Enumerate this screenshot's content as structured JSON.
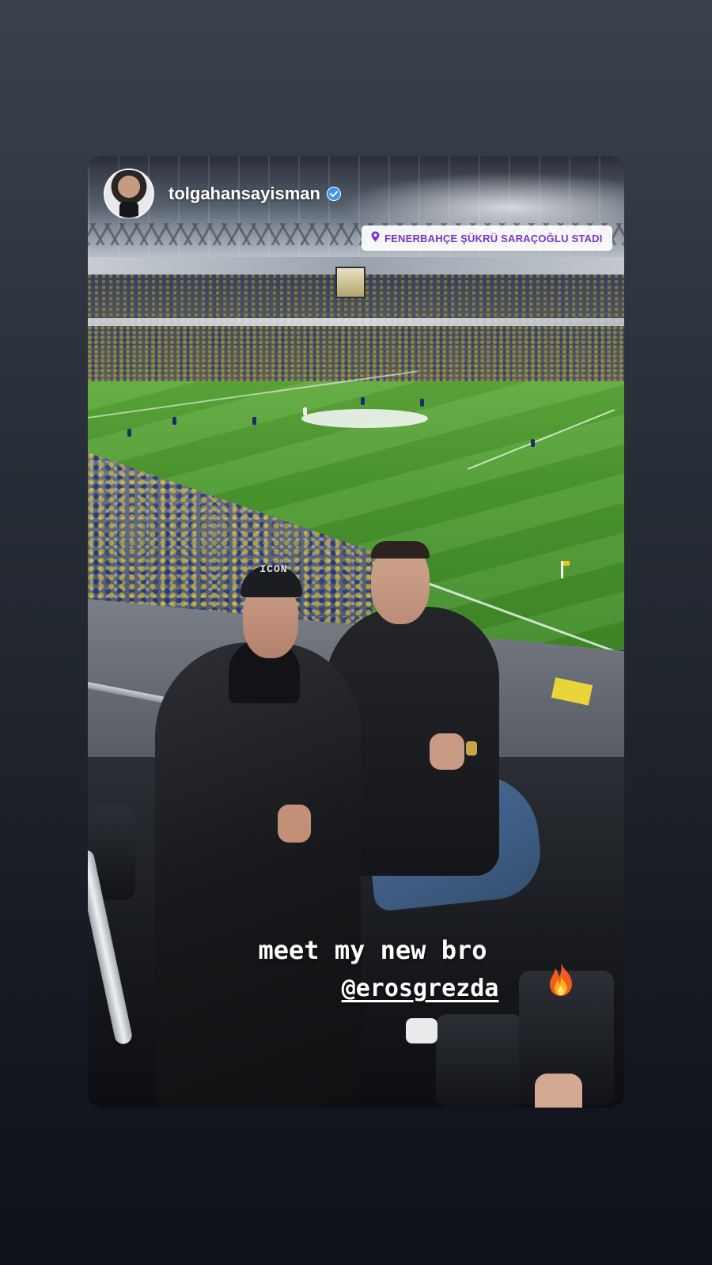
{
  "story": {
    "username": "tolgahansayisman",
    "verified": true,
    "location": "FENERBAHÇE ŞÜKRÜ SARAÇOĞLU STADI",
    "caption": "meet my new bro",
    "mention": "@erosgrezda",
    "cap_text": "ICON",
    "emoji": "fire-emoji",
    "colors": {
      "location_text": "#7a35c8",
      "verified_badge": "#3897f0",
      "caption_text": "#ffffff"
    }
  }
}
